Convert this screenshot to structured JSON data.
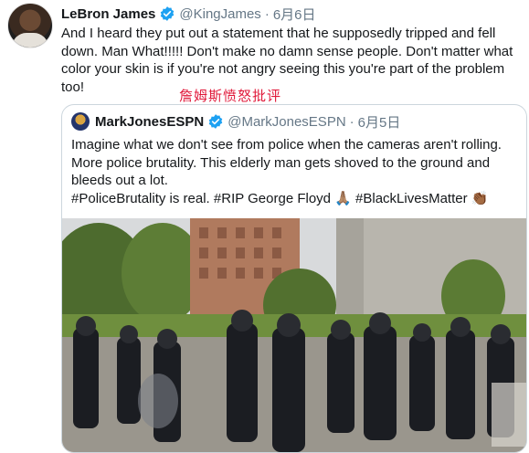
{
  "tweet": {
    "author_name": "LeBron James",
    "author_handle": "@KingJames",
    "separator": "·",
    "date": "6月6日",
    "text": "And I heard they put out a statement that he supposedly tripped and fell down. Man What!!!!! Don't make no damn sense people. Don't matter what color your skin is if you're not angry seeing this you're part of the problem too!"
  },
  "caption_overlay": "詹姆斯愤怒批评",
  "quoted_tweet": {
    "author_name": "MarkJonesESPN",
    "author_handle": "@MarkJonesESPN",
    "separator": "·",
    "date": "6月5日",
    "text_line1": "Imagine what we don't see from police when the cameras aren't rolling. More police brutality. This elderly man gets shoved to the ground and bleeds out a lot.",
    "text_line2": "#PoliceBrutality is real. #RIP George Floyd 🙏🏽 #BlackLivesMatter 👏🏾"
  },
  "colors": {
    "verified": "#1da1f2",
    "secondary_text": "#657786",
    "caption_red": "#e0193a",
    "border": "#ccd6dd"
  },
  "icons": [
    "verified-badge-icon"
  ]
}
